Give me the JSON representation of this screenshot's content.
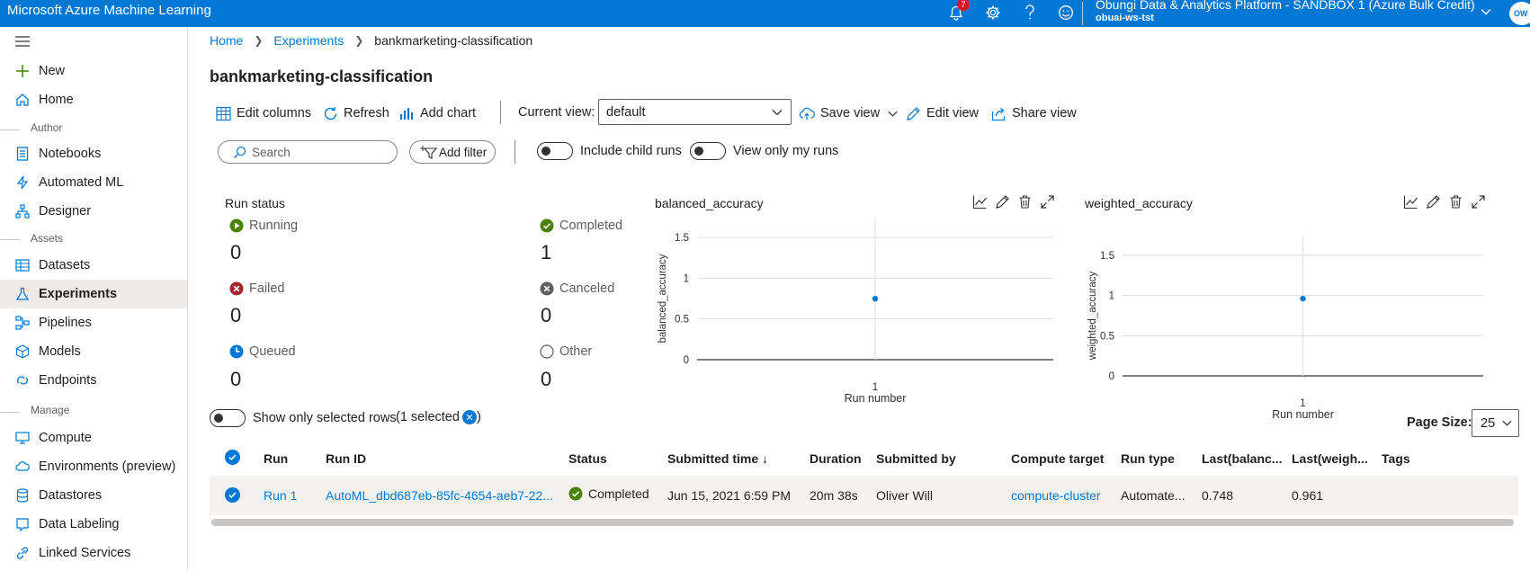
{
  "topbar": {
    "app_title": "Microsoft Azure Machine Learning",
    "notification_count": "7",
    "tenant": "Obungi Data & Analytics Platform - SANDBOX 1 (Azure Bulk Credit)",
    "workspace": "obuai-ws-tst",
    "avatar_initials": "OW"
  },
  "sidebar": {
    "items": [
      {
        "label": "New"
      },
      {
        "label": "Home"
      },
      {
        "label": "Notebooks"
      },
      {
        "label": "Automated ML"
      },
      {
        "label": "Designer"
      },
      {
        "label": "Datasets"
      },
      {
        "label": "Experiments"
      },
      {
        "label": "Pipelines"
      },
      {
        "label": "Models"
      },
      {
        "label": "Endpoints"
      },
      {
        "label": "Compute"
      },
      {
        "label": "Environments (preview)"
      },
      {
        "label": "Datastores"
      },
      {
        "label": "Data Labeling"
      },
      {
        "label": "Linked Services"
      }
    ],
    "sections": {
      "author": "Author",
      "assets": "Assets",
      "manage": "Manage"
    },
    "selected": "Experiments"
  },
  "breadcrumb": {
    "home": "Home",
    "experiments": "Experiments",
    "current": "bankmarketing-classification"
  },
  "page_title": "bankmarketing-classification",
  "toolbar": {
    "edit_columns": "Edit columns",
    "refresh": "Refresh",
    "add_chart": "Add chart",
    "current_view_label": "Current view:",
    "current_view_value": "default",
    "save_view": "Save view",
    "edit_view": "Edit view",
    "share_view": "Share view"
  },
  "filters": {
    "search_placeholder": "Search",
    "add_filter": "Add filter",
    "include_child_runs": "Include child runs",
    "view_only_my_runs": "View only my runs"
  },
  "run_status": {
    "title": "Run status",
    "items": [
      {
        "label": "Running",
        "count": "0"
      },
      {
        "label": "Completed",
        "count": "1"
      },
      {
        "label": "Failed",
        "count": "0"
      },
      {
        "label": "Canceled",
        "count": "0"
      },
      {
        "label": "Queued",
        "count": "0"
      },
      {
        "label": "Other",
        "count": "0"
      }
    ]
  },
  "chart_data": [
    {
      "type": "scatter",
      "title": "balanced_accuracy",
      "xlabel": "Run number",
      "ylabel": "balanced_accuracy",
      "x": [
        1
      ],
      "y": [
        0.748
      ],
      "x_ticks": [
        "1"
      ],
      "y_ticks": [
        "0",
        "0.5",
        "1",
        "1.5"
      ],
      "ylim": [
        0,
        1.5
      ],
      "color": "#0078d4",
      "grid": true
    },
    {
      "type": "scatter",
      "title": "weighted_accuracy",
      "xlabel": "Run number",
      "ylabel": "weighted_accuracy",
      "x": [
        1
      ],
      "y": [
        0.961
      ],
      "x_ticks": [
        "1"
      ],
      "y_ticks": [
        "0",
        "0.5",
        "1",
        "1.5"
      ],
      "ylim": [
        0,
        1.5
      ],
      "color": "#0078d4",
      "grid": true
    }
  ],
  "selection": {
    "show_only_selected": "Show only selected rows",
    "selected_count": "(1 selected",
    "close_paren": ")"
  },
  "page_size": {
    "label": "Page Size:",
    "value": "25"
  },
  "table": {
    "columns": [
      "Run",
      "Run ID",
      "Status",
      "Submitted time",
      "Duration",
      "Submitted by",
      "Compute target",
      "Run type",
      "Last(balanc...",
      "Last(weigh...",
      "Tags"
    ],
    "sort_indicator": "↓",
    "rows": [
      {
        "run": "Run 1",
        "run_id": "AutoML_dbd687eb-85fc-4654-aeb7-22...",
        "status": "Completed",
        "submitted_time": "Jun 15, 2021 6:59 PM",
        "duration": "20m 38s",
        "submitted_by": "Oliver Will",
        "compute_target": "compute-cluster",
        "run_type": "Automate...",
        "last_balanced": "0.748",
        "last_weighted": "0.961",
        "tags": ""
      }
    ]
  }
}
